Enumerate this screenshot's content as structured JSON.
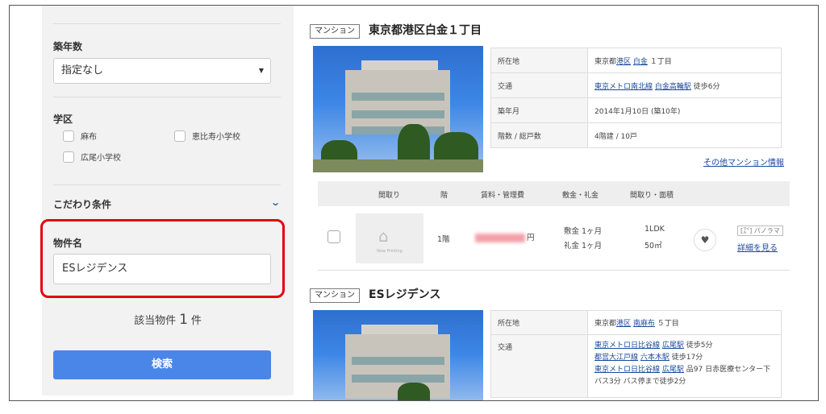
{
  "sidebar": {
    "age": {
      "title": "築年数",
      "value": "指定なし"
    },
    "school": {
      "title": "学区",
      "options": [
        "麻布",
        "恵比寿小学校",
        "広尾小学校"
      ]
    },
    "features": {
      "title": "こだわり条件"
    },
    "name": {
      "title": "物件名",
      "value": "ESレジデンス"
    },
    "count": {
      "prefix": "該当物件",
      "number": "1",
      "suffix": "件"
    },
    "search_label": "検索"
  },
  "listings": [
    {
      "tag": "マンション",
      "title": "東京都港区白金１丁目",
      "info": {
        "address_label": "所在地",
        "address_pre": "東京都",
        "address_link1": "港区",
        "address_link2": "白金",
        "address_post": "１丁目",
        "access_label": "交通",
        "access_line": "東京メトロ南北線",
        "access_station": "白金高輪駅",
        "access_walk": "徒歩6分",
        "built_label": "築年月",
        "built_value": "2014年1月10日 (築10年)",
        "floors_label": "階数 / 総戸数",
        "floors_value": "4階建 / 10戸"
      },
      "more_link": "その他マンション情報",
      "list_header": {
        "layout": "間取り",
        "floor": "階",
        "rent": "賃料・管理費",
        "deposit": "敷金・礼金",
        "area": "間取り・面積"
      },
      "unit": {
        "thumb_text": "Now Printing",
        "floor": "1階",
        "rent_unit": "円",
        "deposit": "敷金 1ヶ月",
        "key_money": "礼金 1ヶ月",
        "layout": "1LDK",
        "area": "50㎡",
        "panorama": "[㍄] パノラマ",
        "detail_link": "詳細を見る"
      }
    },
    {
      "tag": "マンション",
      "title": "ESレジデンス",
      "info": {
        "address_label": "所在地",
        "address_pre": "東京都",
        "address_link1": "港区",
        "address_link2": "南麻布",
        "address_post": "５丁目",
        "access_label": "交通",
        "access1_line": "東京メトロ日比谷線",
        "access1_station": "広尾駅",
        "access1_walk": "徒歩5分",
        "access2_line": "都営大江戸線",
        "access2_station": "六本木駅",
        "access2_walk": "徒歩17分",
        "access3_line": "東京メトロ日比谷線",
        "access3_station": "広尾駅",
        "access3_walk": "品97 日赤医療センター下 バス3分 バス停まで徒歩2分"
      }
    }
  ]
}
